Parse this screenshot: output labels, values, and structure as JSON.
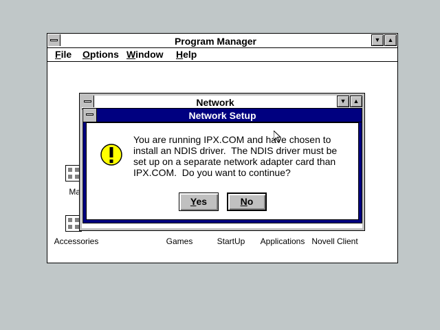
{
  "program_manager": {
    "title": "Program Manager",
    "menu": [
      {
        "key": "F",
        "rest": "ile"
      },
      {
        "key": "O",
        "rest": "ptions"
      },
      {
        "key": "W",
        "rest": "indow"
      },
      {
        "key": "H",
        "rest": "elp"
      }
    ],
    "groups": {
      "main_partial": "Mai",
      "accessories": "Accessories",
      "games": "Games",
      "startup": "StartUp",
      "applications": "Applications",
      "novell_client": "Novell Client"
    }
  },
  "network_window": {
    "title": "Network"
  },
  "dialog": {
    "title": "Network Setup",
    "message_lines": [
      "You are running IPX.COM and have chosen to",
      "install an NDIS driver.  The NDIS driver must be",
      "set up on a separate network adapter card than",
      "IPX.COM.  Do you want to continue?"
    ],
    "yes_key": "Y",
    "yes_rest": "es",
    "no_key": "N",
    "no_rest": "o"
  },
  "icons": {
    "warning": "exclamation-warning-icon",
    "system_menu": "system-menu-icon",
    "minimize": "minimize-arrow-icon",
    "maximize": "maximize-arrow-icon"
  },
  "colors": {
    "desktop": "#c0c7c8",
    "active_title": "#000080",
    "warning_fill": "#ffff00"
  }
}
